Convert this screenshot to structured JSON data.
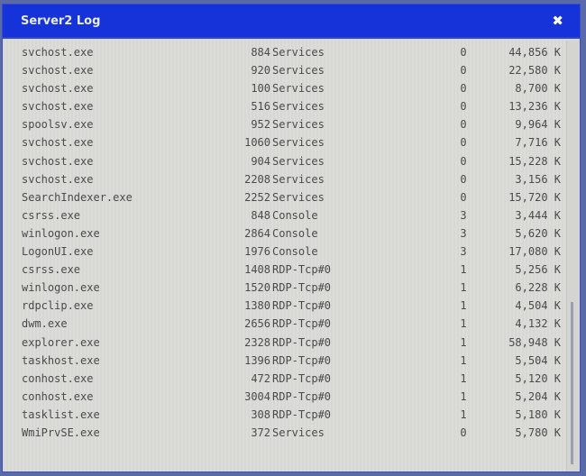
{
  "window": {
    "title": "Server2 Log",
    "close_label": "✖"
  },
  "processes": [
    {
      "name": "svchost.exe",
      "pid": "884",
      "session": "Services",
      "session_num": "0",
      "mem": "44,856 K"
    },
    {
      "name": "svchost.exe",
      "pid": "920",
      "session": "Services",
      "session_num": "0",
      "mem": "22,580 K"
    },
    {
      "name": "svchost.exe",
      "pid": "100",
      "session": "Services",
      "session_num": "0",
      "mem": "8,700 K"
    },
    {
      "name": "svchost.exe",
      "pid": "516",
      "session": "Services",
      "session_num": "0",
      "mem": "13,236 K"
    },
    {
      "name": "spoolsv.exe",
      "pid": "952",
      "session": "Services",
      "session_num": "0",
      "mem": "9,964 K"
    },
    {
      "name": "svchost.exe",
      "pid": "1060",
      "session": "Services",
      "session_num": "0",
      "mem": "7,716 K"
    },
    {
      "name": "svchost.exe",
      "pid": "904",
      "session": "Services",
      "session_num": "0",
      "mem": "15,228 K"
    },
    {
      "name": "svchost.exe",
      "pid": "2208",
      "session": "Services",
      "session_num": "0",
      "mem": "3,156 K"
    },
    {
      "name": "SearchIndexer.exe",
      "pid": "2252",
      "session": "Services",
      "session_num": "0",
      "mem": "15,720 K"
    },
    {
      "name": "csrss.exe",
      "pid": "848",
      "session": "Console",
      "session_num": "3",
      "mem": "3,444 K"
    },
    {
      "name": "winlogon.exe",
      "pid": "2864",
      "session": "Console",
      "session_num": "3",
      "mem": "5,620 K"
    },
    {
      "name": "LogonUI.exe",
      "pid": "1976",
      "session": "Console",
      "session_num": "3",
      "mem": "17,080 K"
    },
    {
      "name": "csrss.exe",
      "pid": "1408",
      "session": "RDP-Tcp#0",
      "session_num": "1",
      "mem": "5,256 K"
    },
    {
      "name": "winlogon.exe",
      "pid": "1520",
      "session": "RDP-Tcp#0",
      "session_num": "1",
      "mem": "6,228 K"
    },
    {
      "name": "rdpclip.exe",
      "pid": "1380",
      "session": "RDP-Tcp#0",
      "session_num": "1",
      "mem": "4,504 K"
    },
    {
      "name": "dwm.exe",
      "pid": "2656",
      "session": "RDP-Tcp#0",
      "session_num": "1",
      "mem": "4,132 K"
    },
    {
      "name": "explorer.exe",
      "pid": "2328",
      "session": "RDP-Tcp#0",
      "session_num": "1",
      "mem": "58,948 K"
    },
    {
      "name": "taskhost.exe",
      "pid": "1396",
      "session": "RDP-Tcp#0",
      "session_num": "1",
      "mem": "5,504 K"
    },
    {
      "name": "conhost.exe",
      "pid": "472",
      "session": "RDP-Tcp#0",
      "session_num": "1",
      "mem": "5,120 K"
    },
    {
      "name": "conhost.exe",
      "pid": "3004",
      "session": "RDP-Tcp#0",
      "session_num": "1",
      "mem": "5,204 K"
    },
    {
      "name": "tasklist.exe",
      "pid": "308",
      "session": "RDP-Tcp#0",
      "session_num": "1",
      "mem": "5,180 K"
    },
    {
      "name": "WmiPrvSE.exe",
      "pid": "372",
      "session": "Services",
      "session_num": "0",
      "mem": "5,780 K"
    }
  ]
}
